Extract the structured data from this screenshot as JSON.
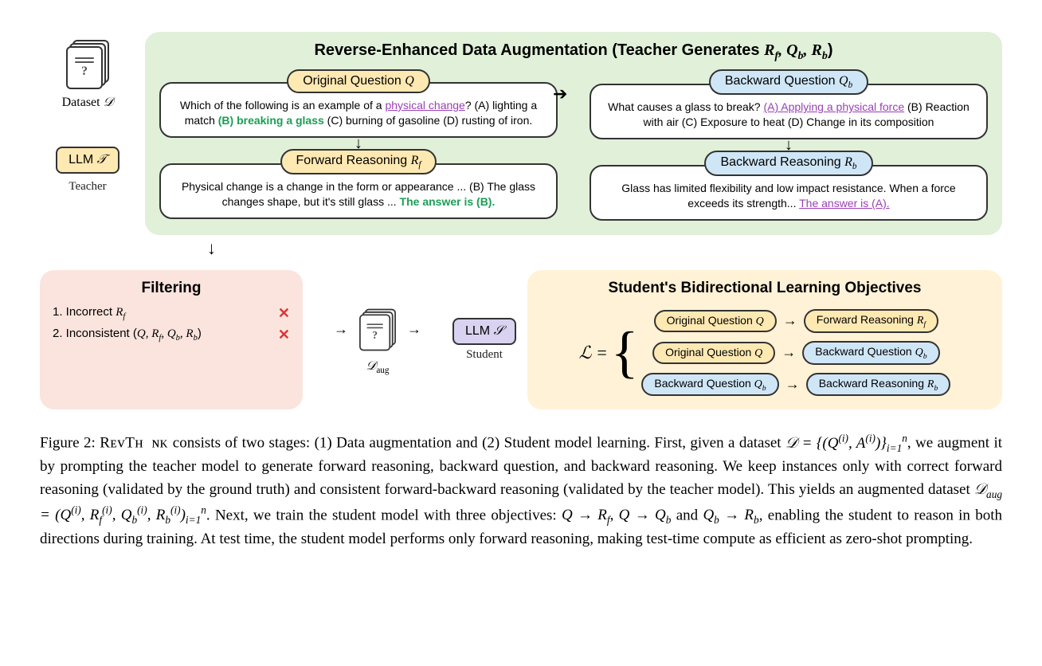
{
  "left": {
    "dataset_label": "Dataset 𝒟",
    "teacher_chip": "LLM 𝒯",
    "teacher_sublabel": "Teacher"
  },
  "green": {
    "title_prefix": "Reverse-Enhanced Data Augmentation (Teacher Generates ",
    "title_math": "R_f, Q_b, R_b",
    "title_suffix": ")",
    "origQ_label": "Original Question Q",
    "origQ_text_pre": "Which of the following is an example of a ",
    "origQ_underline": "physical change",
    "origQ_text_mid": "? (A) lighting a match ",
    "origQ_bold": "(B) breaking a glass",
    "origQ_text_post": " (C) burning of gasoline (D) rusting of iron.",
    "fwdR_label": "Forward Reasoning R_f",
    "fwdR_text_pre": "Physical change is a change in the form or appearance ... (B) The glass changes shape, but it's still glass ... ",
    "fwdR_answer": "The answer is (B).",
    "backQ_label": "Backward Question Q_b",
    "backQ_text_pre": "What causes a glass to break? ",
    "backQ_underline": "(A) Applying a physical force",
    "backQ_text_post": " (B) Reaction with air (C) Exposure to heat (D) Change in its composition",
    "backR_label": "Backward Reasoning R_b",
    "backR_text_pre": "Glass has limited flexibility and low impact resistance. When a force exceeds its strength... ",
    "backR_answer": "The answer is (A)."
  },
  "pink": {
    "title": "Filtering",
    "line1": "1. Incorrect R_f",
    "line2": "2. Inconsistent (Q, R_f, Q_b, R_b)"
  },
  "mid": {
    "daug": "𝒟_aug",
    "student_chip": "LLM 𝒮",
    "student_sublabel": "Student"
  },
  "yellow": {
    "title": "Student's Bidirectional Learning Objectives",
    "L": "ℒ =",
    "rows": [
      {
        "from": "Original Question Q",
        "fromColor": "orange",
        "to": "Forward Reasoning R_f",
        "toColor": "orange"
      },
      {
        "from": "Original Question Q",
        "fromColor": "orange",
        "to": "Backward Question Q_b",
        "toColor": "blue"
      },
      {
        "from": "Backward Question Q_b",
        "fromColor": "blue",
        "to": "Backward Reasoning R_b",
        "toColor": "blue"
      }
    ]
  },
  "caption": {
    "fignum": "Figure 2: ",
    "name": "RevThink",
    "p1": " consists of two stages: (1) Data augmentation and (2) Student model learning. First, given a dataset ",
    "eq1": "𝒟 = {(Q^(i), A^(i))}_{i=1}^n",
    "p2": ", we augment it by prompting the teacher model to generate forward reasoning, backward question, and backward reasoning. We keep instances only with correct forward reasoning (validated by the ground truth) and consistent forward-backward reasoning (validated by the teacher model). This yields an augmented dataset ",
    "eq2": "𝒟_aug = (Q^(i), R_f^(i), Q_b^(i), R_b^(i))_{i=1}^n",
    "p3": ". Next, we train the student model with three objectives: ",
    "eq3": "Q → R_f, Q → Q_b and Q_b → R_b",
    "p4": ", enabling the student to reason in both directions during training. At test time, the student model performs only forward reasoning, making test-time compute as efficient as zero-shot prompting."
  }
}
